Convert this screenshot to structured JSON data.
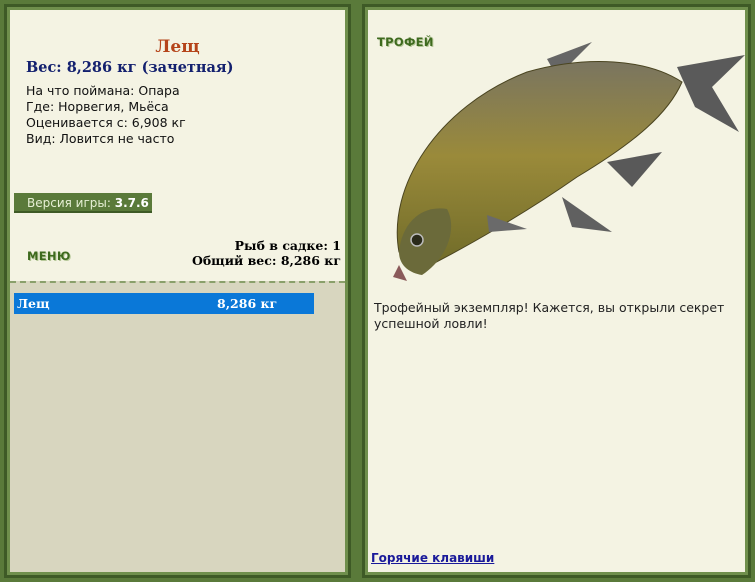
{
  "fish": {
    "name": "Лещ",
    "weight_line": "Вес: 8,286 кг (зачетная)",
    "bait": "На что поймана: Опара",
    "location": "Где: Норвегия, Мьёса",
    "rated_from": "Оценивается с: 6,908 кг",
    "frequency": "Вид: Ловится не часто"
  },
  "version": {
    "label": "Версия игры:",
    "value": "3.7.6"
  },
  "menu_label": "МЕНЮ",
  "stats": {
    "fish_count": "Рыб в садке: 1",
    "total_weight": "Общий вес: 8,286 кг"
  },
  "keepnet": [
    {
      "name": "Лещ",
      "weight": "8,286 кг"
    }
  ],
  "trophy": {
    "title": "ТРОФЕЙ",
    "text": "Трофейный экземпляр! Кажется, вы открыли секрет успешной ловли!"
  },
  "hotkeys_link": "Горячие клавиши",
  "colors": {
    "accent_green": "#5a7a3a",
    "selected_row": "#0a78d8",
    "fish_name": "#b5441a",
    "weight_text": "#13206e"
  },
  "icons": {
    "fish_picture": "bream-fish-image"
  }
}
